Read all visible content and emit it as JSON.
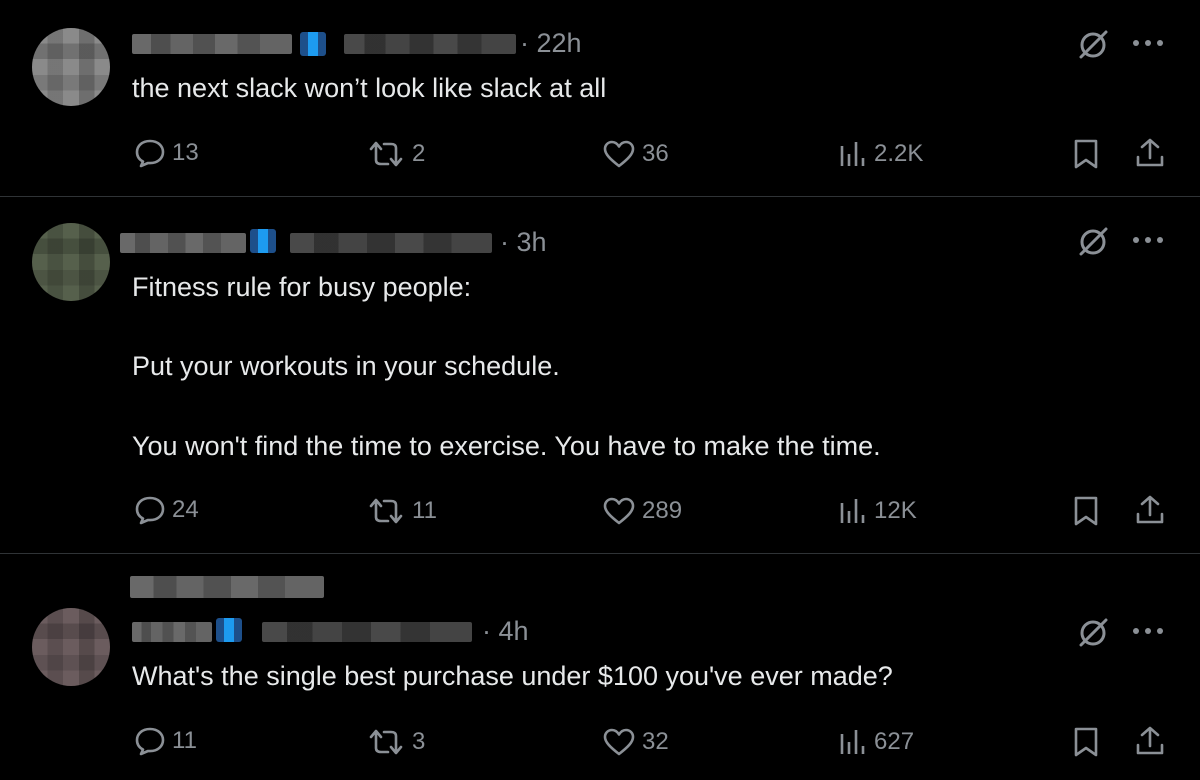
{
  "posts": [
    {
      "time": "· 22h",
      "text_lines": [
        "the next slack won’t look like slack at all"
      ],
      "replies": "13",
      "reposts": "2",
      "likes": "36",
      "views": "2.2K"
    },
    {
      "time": "· 3h",
      "text_lines": [
        "Fitness rule for busy people:",
        "Put your workouts in your schedule.",
        "You won't find the time to exercise. You have to make the time."
      ],
      "replies": "24",
      "reposts": "11",
      "likes": "289",
      "views": "12K"
    },
    {
      "time": "· 4h",
      "text_lines": [
        "What's the single best purchase under $100 you've ever made?"
      ],
      "replies": "11",
      "reposts": "3",
      "likes": "32",
      "views": "627"
    }
  ],
  "icons": {
    "reply": "speech-bubble-icon",
    "repost": "repost-arrows-icon",
    "like": "heart-icon",
    "views": "bar-chart-icon",
    "bookmark": "bookmark-icon",
    "share": "upload-icon",
    "grok": "slashed-circle-icon",
    "more": "ellipsis-icon"
  },
  "colors": {
    "background": "#000000",
    "text": "#e7e9ea",
    "secondary": "#8b9096",
    "divider": "#2f3336",
    "verified": "#1d9bf0"
  }
}
